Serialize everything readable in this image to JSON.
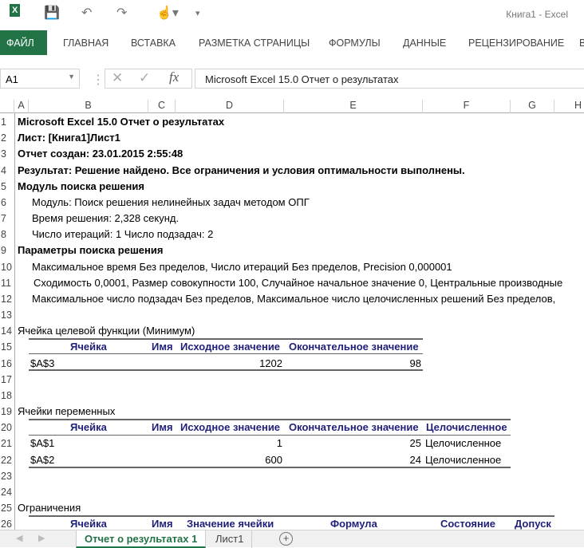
{
  "window": {
    "title": "Книга1 - Excel"
  },
  "ribbon": {
    "tabs": [
      "ФАЙЛ",
      "ГЛАВНАЯ",
      "ВСТАВКА",
      "РАЗМЕТКА СТРАНИЦЫ",
      "ФОРМУЛЫ",
      "ДАННЫЕ",
      "РЕЦЕНЗИРОВАНИЕ",
      "В"
    ]
  },
  "formula_bar": {
    "name_box": "A1",
    "fx": "fx",
    "formula": "Microsoft Excel 15.0 Отчет о результатах"
  },
  "columns": [
    "A",
    "B",
    "C",
    "D",
    "E",
    "F",
    "G",
    "H"
  ],
  "rows": [
    "1",
    "2",
    "3",
    "4",
    "5",
    "6",
    "7",
    "8",
    "9",
    "10",
    "11",
    "12",
    "13",
    "14",
    "15",
    "16",
    "17",
    "18",
    "19",
    "20",
    "21",
    "22",
    "23",
    "24",
    "25",
    "26"
  ],
  "report": {
    "r1": "Microsoft Excel 15.0 Отчет о результатах",
    "r2": "Лист: [Книга1]Лист1",
    "r3": "Отчет создан: 23.01.2015 2:55:48",
    "r4": "Результат: Решение найдено. Все ограничения и условия оптимальности выполнены.",
    "r5": "Модуль поиска решения",
    "r6": "Модуль: Поиск решения нелинейных задач методом ОПГ",
    "r7": "Время решения: 2,328 секунд.",
    "r8": "Число итераций: 1 Число подзадач: 2",
    "r9": "Параметры поиска решения",
    "r10": "Максимальное время Без пределов,  Число итераций Без пределов, Precision 0,000001",
    "r11": "Сходимость 0,0001, Размер совокупности 100, Случайное начальное значение 0, Центральные производные",
    "r12": "Максимальное число подзадач Без пределов, Максимальное число целочисленных решений Без пределов,",
    "r14": "Ячейка целевой функции (Минимум)",
    "r19": "Ячейки переменных",
    "r25": "Ограничения"
  },
  "objective": {
    "headers": [
      "Ячейка",
      "Имя",
      "Исходное значение",
      "Окончательное значение"
    ],
    "rows": [
      [
        "$A$3",
        "",
        "1202",
        "98"
      ]
    ]
  },
  "variables": {
    "headers": [
      "Ячейка",
      "Имя",
      "Исходное значение",
      "Окончательное значение",
      "Целочисленное"
    ],
    "rows": [
      [
        "$A$1",
        "",
        "1",
        "25",
        "Целочисленное"
      ],
      [
        "$A$2",
        "",
        "600",
        "24",
        "Целочисленное"
      ]
    ]
  },
  "constraints": {
    "headers": [
      "Ячейка",
      "Имя",
      "Значение ячейки",
      "Формула",
      "Состояние",
      "Допуск"
    ]
  },
  "sheets": {
    "active": "Отчет о результатах 1",
    "other": "Лист1",
    "add": "+"
  }
}
